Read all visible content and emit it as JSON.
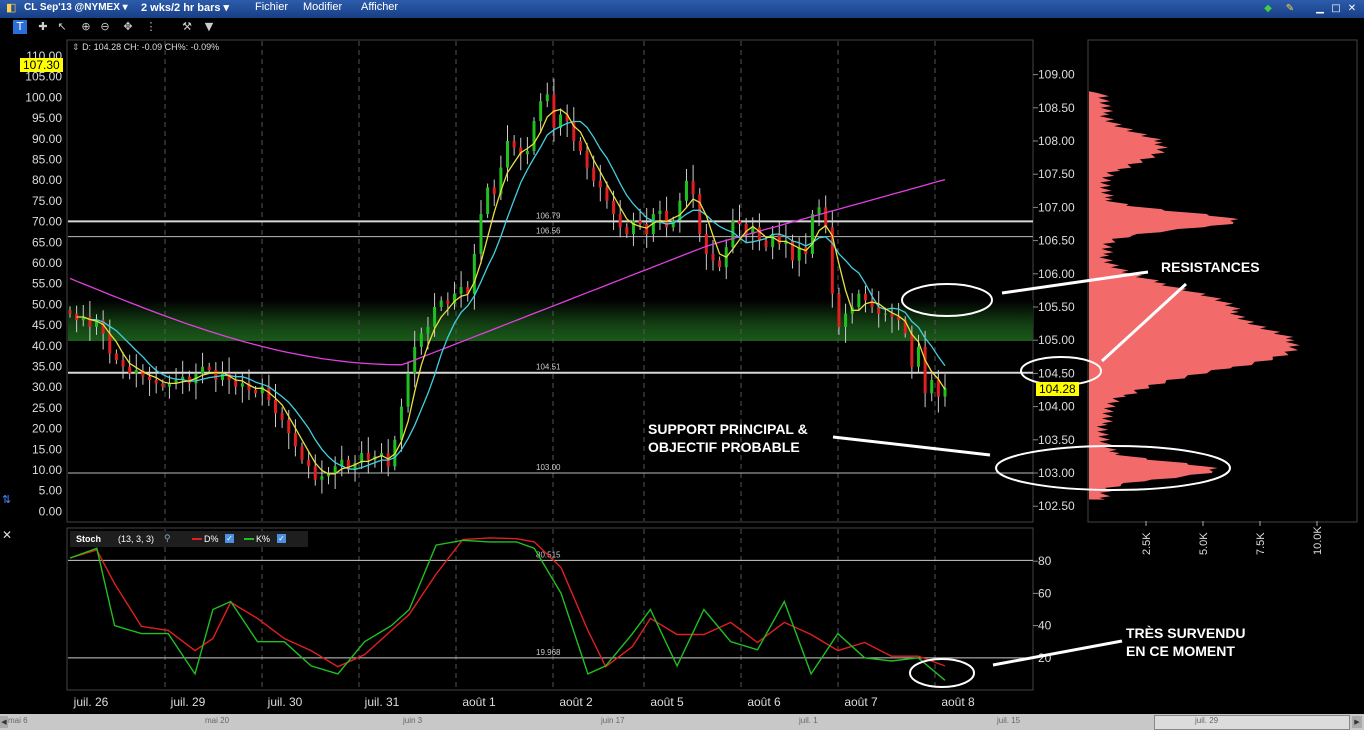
{
  "titlebar": {
    "symbol": "CL Sep'13 @NYMEX",
    "period": "2 wks/2 hr bars",
    "menu": [
      "Fichier",
      "Modifier",
      "Afficher"
    ]
  },
  "toolbar": {
    "icons": [
      "crosshair-icon",
      "cursor-icon",
      "zoom-in-icon",
      "zoom-out-icon",
      "pan-icon",
      "properties-icon",
      "settings-icon",
      "more-icon"
    ]
  },
  "price_panel": {
    "readout": "D: 104.28 CH: -0.09 CH%: -0.09%",
    "left_axis": [
      "110.00",
      "105.00",
      "100.00",
      "95.00",
      "90.00",
      "85.00",
      "80.00",
      "75.00",
      "70.00",
      "65.00",
      "60.00",
      "55.00",
      "50.00",
      "45.00",
      "40.00",
      "35.00",
      "30.00",
      "25.00",
      "20.00",
      "15.00",
      "10.00",
      "5.00",
      "0.00"
    ],
    "left_flag": "107.30",
    "right_axis": [
      "109.00",
      "108.50",
      "108.00",
      "107.50",
      "107.00",
      "106.50",
      "106.00",
      "105.50",
      "105.00",
      "104.50",
      "104.00",
      "103.50",
      "103.00",
      "102.50"
    ],
    "last_price": "104.28",
    "level_labels": [
      "106.79",
      "106.56",
      "104.51",
      "103.00"
    ],
    "levels": [
      106.79,
      106.56,
      104.51,
      103.0
    ],
    "colors": {
      "ma_slow": "#e040e0",
      "ma_mid": "#40d0e0",
      "ma_fast": "#e8e040",
      "up": "#20c020",
      "down": "#e02020",
      "zone": "#1a5a1a"
    }
  },
  "stoch_panel": {
    "name": "Stoch",
    "params": "(13, 3, 3)",
    "d_label": "D%",
    "k_label": "K%",
    "axis": [
      "80",
      "60",
      "40",
      "20"
    ],
    "level_labels": [
      "80.515",
      "19.968"
    ],
    "levels": [
      80.515,
      19.968
    ],
    "colors": {
      "d": "#e02020",
      "k": "#20c020"
    }
  },
  "x_axis": [
    "juil. 26",
    "juil. 29",
    "juil. 30",
    "juil. 31",
    "août 1",
    "août 2",
    "août 5",
    "août 6",
    "août 7",
    "août 8"
  ],
  "volume_profile": {
    "axis": [
      "2.5K",
      "5.0K",
      "7.5K",
      "10.0K"
    ],
    "color": "#f26a6a"
  },
  "scrollbar": {
    "labels": [
      "mai 6",
      "mai 20",
      "juin 3",
      "juin 17",
      "juil. 1",
      "juil. 15",
      "juil. 29"
    ]
  },
  "annotations": {
    "resistances": "RESISTANCES",
    "support_1": "SUPPORT PRINCIPAL &",
    "support_2": "OBJECTIF PROBABLE",
    "oversold_1": "TRÈS SURVENDU",
    "oversold_2": "EN CE MOMENT"
  },
  "chart_data": {
    "type": "candlestick",
    "x_ticks": [
      "juil. 26",
      "juil. 29",
      "juil. 30",
      "juil. 31",
      "août 1",
      "août 2",
      "août 5",
      "août 6",
      "août 7",
      "août 8"
    ],
    "y_range": [
      102.25,
      109.25
    ],
    "horizontal_levels": [
      106.79,
      106.56,
      104.51,
      103.0
    ],
    "close": [
      105.4,
      105.3,
      105.35,
      105.2,
      105.3,
      105.1,
      104.8,
      104.7,
      104.6,
      104.5,
      104.55,
      104.45,
      104.4,
      104.35,
      104.3,
      104.35,
      104.4,
      104.45,
      104.35,
      104.5,
      104.6,
      104.55,
      104.4,
      104.5,
      104.4,
      104.3,
      104.35,
      104.25,
      104.2,
      104.3,
      104.1,
      103.9,
      103.8,
      103.6,
      103.4,
      103.2,
      103.1,
      102.9,
      102.95,
      103.0,
      103.1,
      103.2,
      103.05,
      103.15,
      103.3,
      103.2,
      103.25,
      103.3,
      103.1,
      103.5,
      104.0,
      104.5,
      104.9,
      105.1,
      105.2,
      105.5,
      105.6,
      105.55,
      105.7,
      105.8,
      105.7,
      106.3,
      106.9,
      107.3,
      107.2,
      107.6,
      108.0,
      107.9,
      107.8,
      107.85,
      108.3,
      108.6,
      108.7,
      108.2,
      108.4,
      108.3,
      108.0,
      107.85,
      107.6,
      107.4,
      107.3,
      107.1,
      106.9,
      106.7,
      106.6,
      106.8,
      106.75,
      106.6,
      106.9,
      106.95,
      106.7,
      106.8,
      107.1,
      107.4,
      107.2,
      106.6,
      106.3,
      106.2,
      106.1,
      106.4,
      106.8,
      106.75,
      106.6,
      106.7,
      106.5,
      106.4,
      106.6,
      106.45,
      106.5,
      106.2,
      106.4,
      106.3,
      106.9,
      107.0,
      106.7,
      105.7,
      105.2,
      105.4,
      105.5,
      105.7,
      105.6,
      105.5,
      105.4,
      105.4,
      105.35,
      105.3,
      105.1,
      104.6,
      104.9,
      104.2,
      104.4,
      104.15,
      104.28
    ]
  }
}
